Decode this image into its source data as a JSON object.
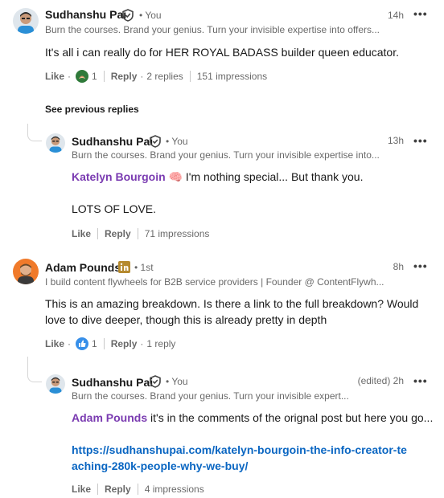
{
  "colors": {
    "mention": "#7a3bb1",
    "link": "#0a66c2"
  },
  "see_previous": "See previous replies",
  "comments": [
    {
      "author": "Sudhanshu Pai",
      "badge": "verified-shield-icon",
      "degree": "• You",
      "headline": "Burn the courses. Brand your genius. Turn your invisible expertise into offers...",
      "time": "14h",
      "text": "It's all i can really do for HER ROYAL BADASS builder queen educator.",
      "actions": {
        "like": "Like",
        "reaction_count": "1",
        "reply": "Reply",
        "replies": "2 replies",
        "impressions": "151 impressions"
      }
    },
    {
      "author": "Sudhanshu Pai",
      "badge": "verified-shield-icon",
      "degree": "• You",
      "headline": "Burn the courses. Brand your genius. Turn your invisible expertise into...",
      "time": "13h",
      "mention": "Katelyn Bourgoin",
      "mention_emoji": "🧠",
      "text": "I'm nothing special... But thank you.",
      "text2": "LOTS OF LOVE.",
      "actions": {
        "like": "Like",
        "reply": "Reply",
        "impressions": "71 impressions"
      }
    },
    {
      "author": "Adam Pounds",
      "badge": "linkedin-premium-icon",
      "degree": "• 1st",
      "headline": "I build content flywheels for B2B service providers | Founder @ ContentFlywh...",
      "time": "8h",
      "text": "This is an amazing breakdown. Is there a link to the full breakdown? Would love to dive deeper, though this is already pretty in depth",
      "actions": {
        "like": "Like",
        "reaction_count": "1",
        "reply": "Reply",
        "replies": "1 reply"
      }
    },
    {
      "author": "Sudhanshu Pai",
      "badge": "verified-shield-icon",
      "degree": "• You",
      "headline": "Burn the courses. Brand your genius. Turn your invisible expert...",
      "time": "(edited) 2h",
      "mention": "Adam Pounds",
      "text": "it's in the comments of the orignal post but here you go...",
      "link": "https://sudhanshupai.com/katelyn-bourgoin-the-info-creator-teaching-280k-people-why-we-buy/",
      "actions": {
        "like": "Like",
        "reply": "Reply",
        "impressions": "4 impressions"
      }
    }
  ]
}
